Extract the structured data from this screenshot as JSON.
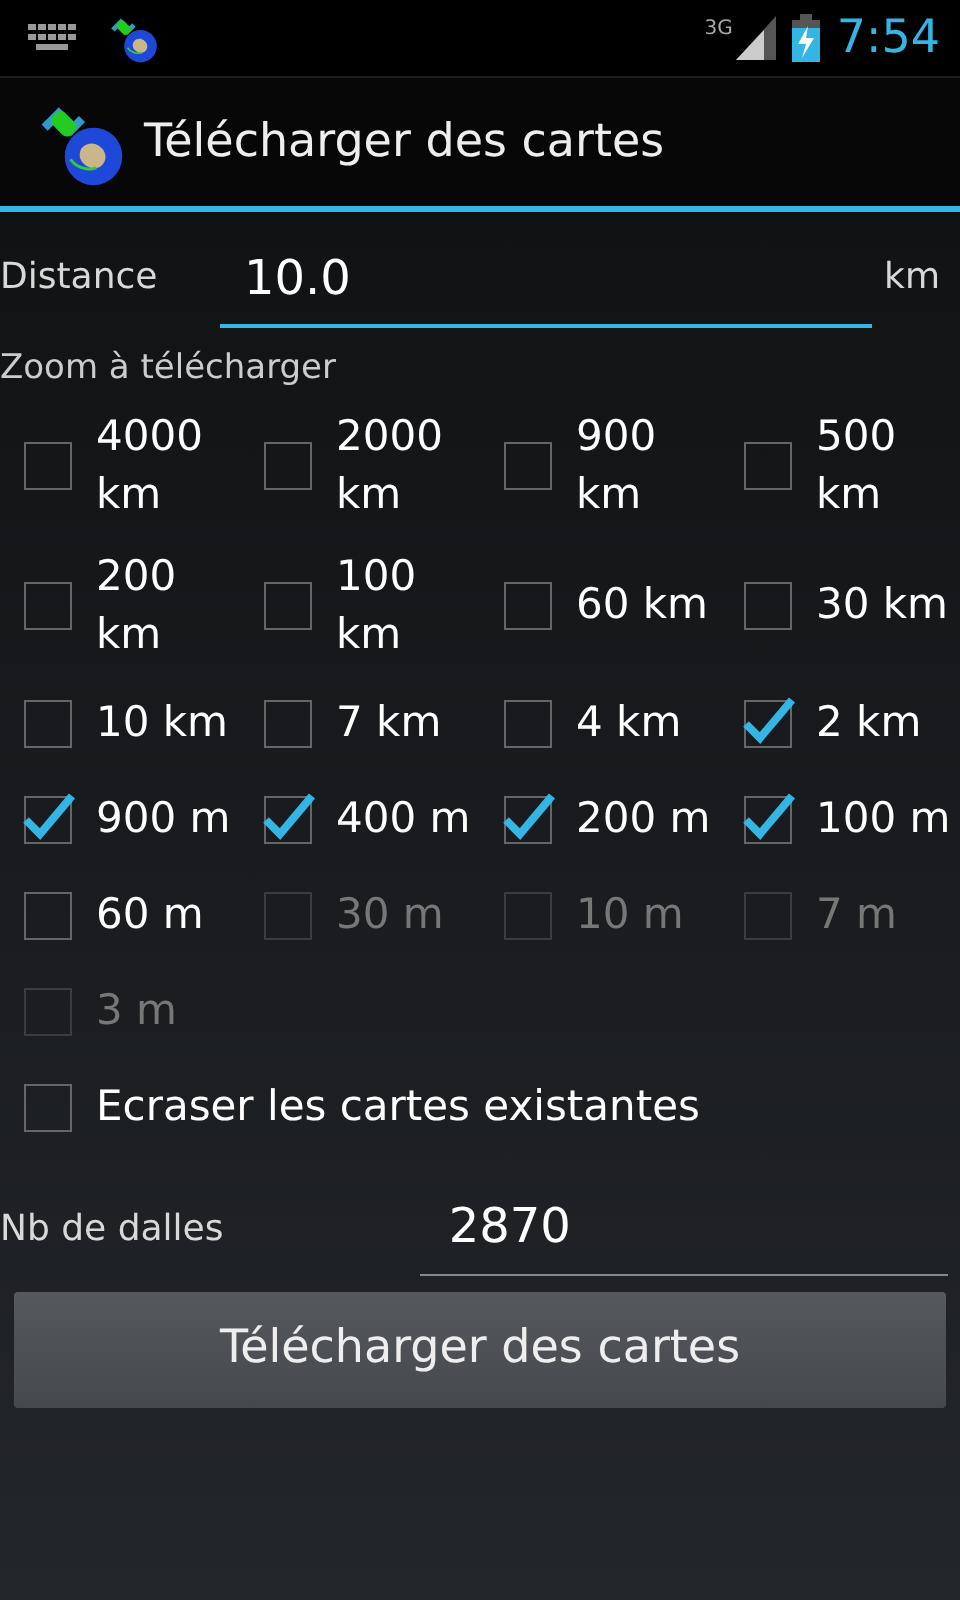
{
  "status_bar": {
    "network": "3G",
    "time": "7:54"
  },
  "title": "Télécharger des cartes",
  "distance": {
    "label": "Distance",
    "value": "10.0",
    "unit": "km"
  },
  "zoom_label": "Zoom à télécharger",
  "zooms": [
    {
      "label": "4000 km",
      "checked": false,
      "disabled": false
    },
    {
      "label": "2000 km",
      "checked": false,
      "disabled": false
    },
    {
      "label": "900 km",
      "checked": false,
      "disabled": false
    },
    {
      "label": "500 km",
      "checked": false,
      "disabled": false
    },
    {
      "label": "200 km",
      "checked": false,
      "disabled": false
    },
    {
      "label": "100 km",
      "checked": false,
      "disabled": false
    },
    {
      "label": "60 km",
      "checked": false,
      "disabled": false
    },
    {
      "label": "30 km",
      "checked": false,
      "disabled": false
    },
    {
      "label": "10 km",
      "checked": false,
      "disabled": false
    },
    {
      "label": "7 km",
      "checked": false,
      "disabled": false
    },
    {
      "label": "4 km",
      "checked": false,
      "disabled": false
    },
    {
      "label": "2 km",
      "checked": true,
      "disabled": false
    },
    {
      "label": "900 m",
      "checked": true,
      "disabled": false
    },
    {
      "label": "400 m",
      "checked": true,
      "disabled": false
    },
    {
      "label": "200 m",
      "checked": true,
      "disabled": false
    },
    {
      "label": "100 m",
      "checked": true,
      "disabled": false
    },
    {
      "label": "60 m",
      "checked": false,
      "disabled": false
    },
    {
      "label": "30 m",
      "checked": false,
      "disabled": true
    },
    {
      "label": "10 m",
      "checked": false,
      "disabled": true
    },
    {
      "label": "7 m",
      "checked": false,
      "disabled": true
    },
    {
      "label": "3 m",
      "checked": false,
      "disabled": true
    }
  ],
  "overwrite": {
    "label": "Ecraser les cartes existantes",
    "checked": false
  },
  "tiles": {
    "label": "Nb de dalles",
    "value": "2870"
  },
  "button": "Télécharger des cartes"
}
